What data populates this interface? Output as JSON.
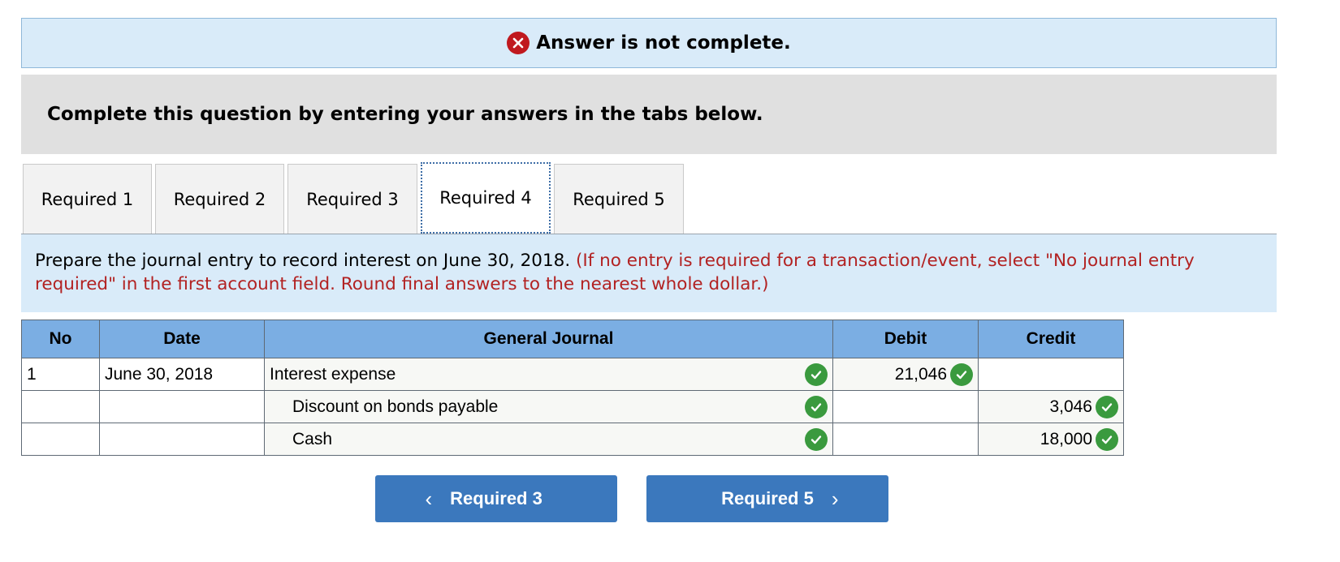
{
  "banner": {
    "icon": "error-x-icon",
    "text": "Answer is not complete."
  },
  "instruction": "Complete this question by entering your answers in the tabs below.",
  "tabs": [
    {
      "label": "Required 1",
      "active": false
    },
    {
      "label": "Required 2",
      "active": false
    },
    {
      "label": "Required 3",
      "active": false
    },
    {
      "label": "Required 4",
      "active": true
    },
    {
      "label": "Required 5",
      "active": false
    }
  ],
  "prompt": {
    "main": "Prepare the journal entry to record interest on June 30, 2018. ",
    "note": "(If no entry is required for a transaction/event, select \"No journal entry required\" in the first account field. Round final answers to the nearest whole dollar.)"
  },
  "journal": {
    "headers": {
      "no": "No",
      "date": "Date",
      "account": "General Journal",
      "debit": "Debit",
      "credit": "Credit"
    },
    "rows": [
      {
        "no": "1",
        "date": "June 30, 2018",
        "account": "Interest expense",
        "debit": "21,046",
        "credit": ""
      },
      {
        "no": "",
        "date": "",
        "account": "Discount on bonds payable",
        "debit": "",
        "credit": "3,046"
      },
      {
        "no": "",
        "date": "",
        "account": "Cash",
        "debit": "",
        "credit": "18,000"
      }
    ]
  },
  "nav": {
    "prev_label": "Required 3",
    "next_label": "Required 5"
  },
  "colors": {
    "check": "#3a9a3e",
    "error": "#c0191f",
    "header_blue": "#7baee3",
    "button_blue": "#3b78bd"
  }
}
